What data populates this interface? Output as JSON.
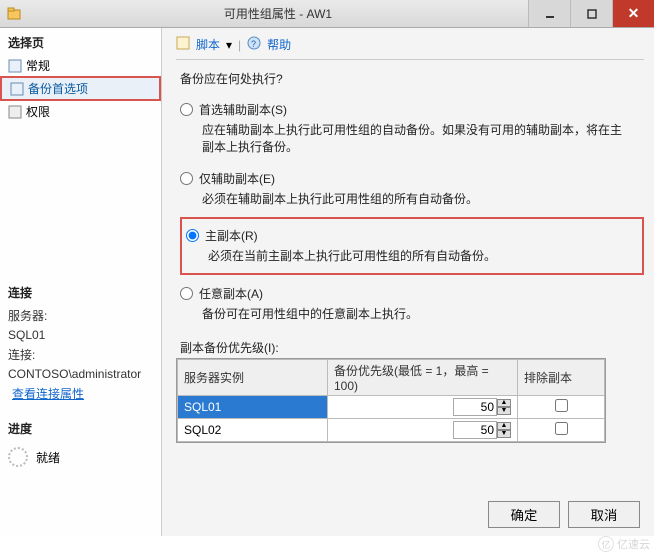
{
  "window": {
    "title": "可用性组属性 - AW1"
  },
  "sidebar": {
    "heading": "选择页",
    "items": [
      {
        "label": "常规"
      },
      {
        "label": "备份首选项",
        "selected": true
      },
      {
        "label": "权限"
      }
    ],
    "conn_heading": "连接",
    "server_label": "服务器:",
    "server_value": "SQL01",
    "conn_label": "连接:",
    "conn_value": "CONTOSO\\administrator",
    "view_conn": "查看连接属性",
    "progress_heading": "进度",
    "status": "就绪"
  },
  "toolbar": {
    "script": "脚本",
    "help": "帮助"
  },
  "main": {
    "question": "备份应在何处执行?",
    "options": [
      {
        "label": "首选辅助副本(S)",
        "desc": "应在辅助副本上执行此可用性组的自动备份。如果没有可用的辅助副本，将在主副本上执行备份。"
      },
      {
        "label": "仅辅助副本(E)",
        "desc": "必须在辅助副本上执行此可用性组的所有自动备份。"
      },
      {
        "label": "主副本(R)",
        "desc": "必须在当前主副本上执行此可用性组的所有自动备份。"
      },
      {
        "label": "任意副本(A)",
        "desc": "备份可在可用性组中的任意副本上执行。"
      }
    ],
    "grid_label": "副本备份优先级(I):",
    "grid": {
      "headers": [
        "服务器实例",
        "备份优先级(最低 = 1，最高 = 100)",
        "排除副本"
      ],
      "rows": [
        {
          "server": "SQL01",
          "priority": "50",
          "exclude": false,
          "selected": true
        },
        {
          "server": "SQL02",
          "priority": "50",
          "exclude": false,
          "selected": false
        }
      ]
    }
  },
  "buttons": {
    "ok": "确定",
    "cancel": "取消"
  },
  "watermark": "亿速云"
}
